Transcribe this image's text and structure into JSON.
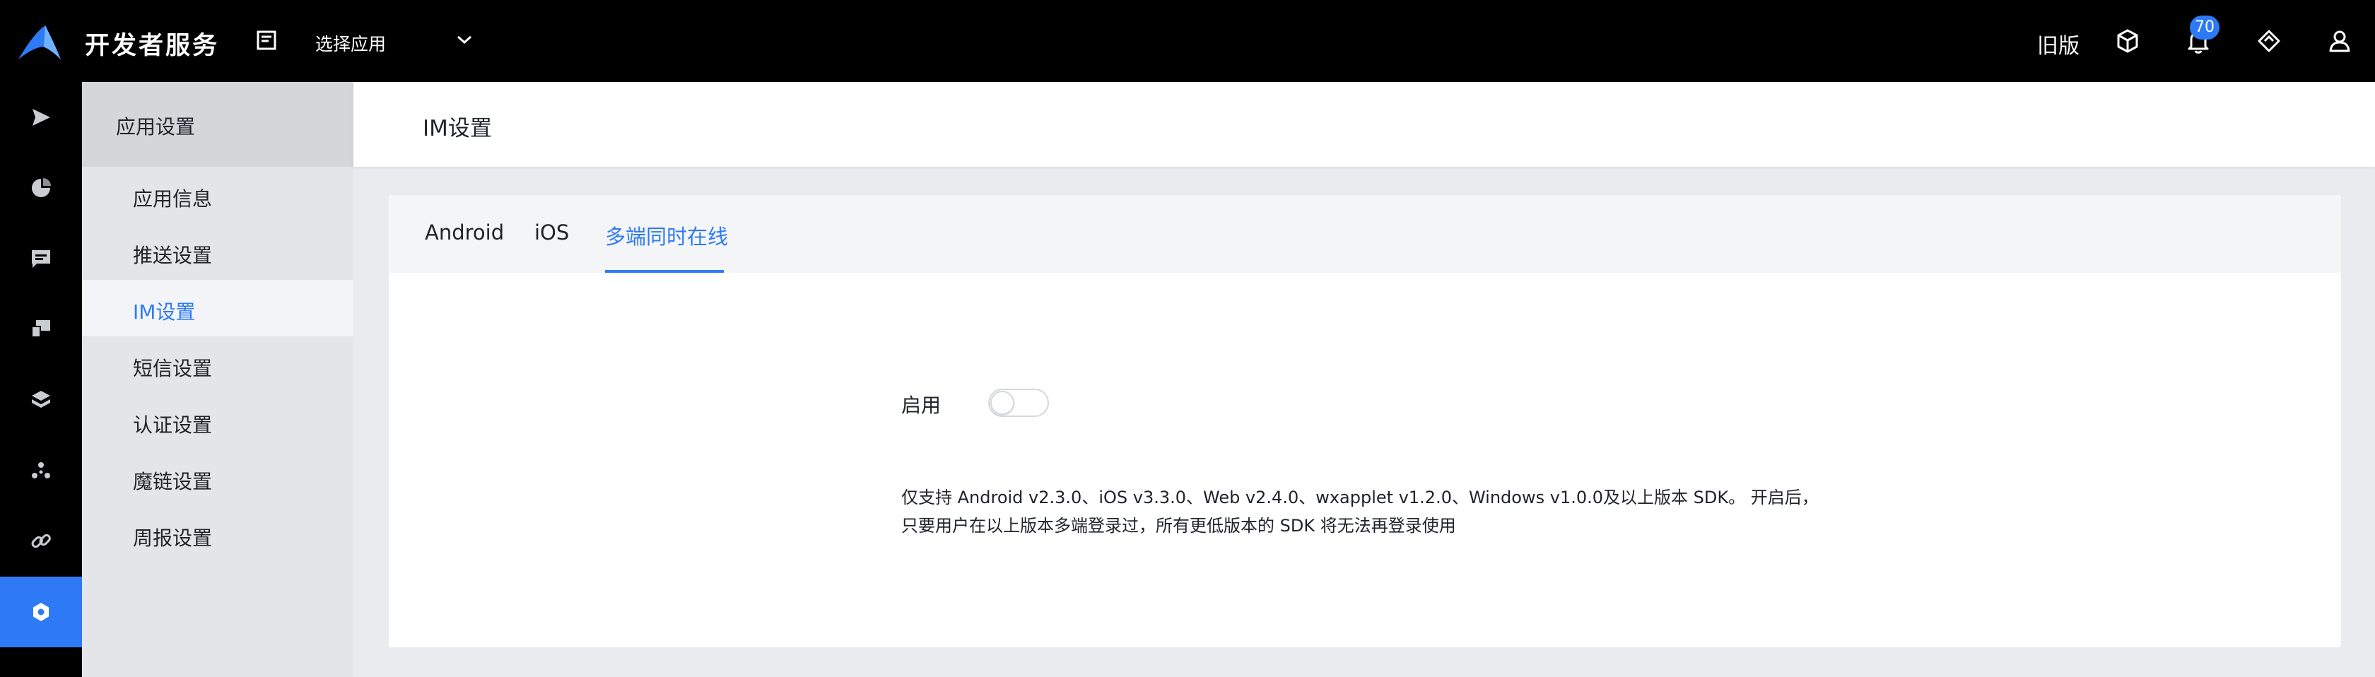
{
  "topbar": {
    "brand": "开发者服务",
    "app_select": "选择应用",
    "old_version": "旧版",
    "notification_count": "70"
  },
  "leftnav": {
    "icons": [
      "send-icon",
      "pie-chart-icon",
      "message-icon",
      "devices-icon",
      "layers-icon",
      "network-icon",
      "link-icon",
      "settings-icon"
    ],
    "active_index": 7
  },
  "sidebar": {
    "heading": "应用设置",
    "items": [
      {
        "label": "应用信息"
      },
      {
        "label": "推送设置"
      },
      {
        "label": "IM设置"
      },
      {
        "label": "短信设置"
      },
      {
        "label": "认证设置"
      },
      {
        "label": "魔链设置"
      },
      {
        "label": "周报设置"
      }
    ],
    "active_index": 2
  },
  "page": {
    "title": "IM设置"
  },
  "tabs": [
    {
      "label": "Android"
    },
    {
      "label": "iOS"
    },
    {
      "label": "多端同时在线"
    }
  ],
  "active_tab": 2,
  "settings": {
    "enable_label": "启用",
    "enabled": false,
    "description": "仅支持 Android v2.3.0、iOS v3.3.0、Web v2.4.0、wxapplet v1.2.0、Windows v1.0.0及以上版本 SDK。 开启后，只要用户在以上版本多端登录过，所有更低版本的 SDK 将无法再登录使用"
  },
  "colors": {
    "accent": "#2e7af6",
    "topbar": "#000000",
    "sidebar": "#e3e5e8"
  }
}
